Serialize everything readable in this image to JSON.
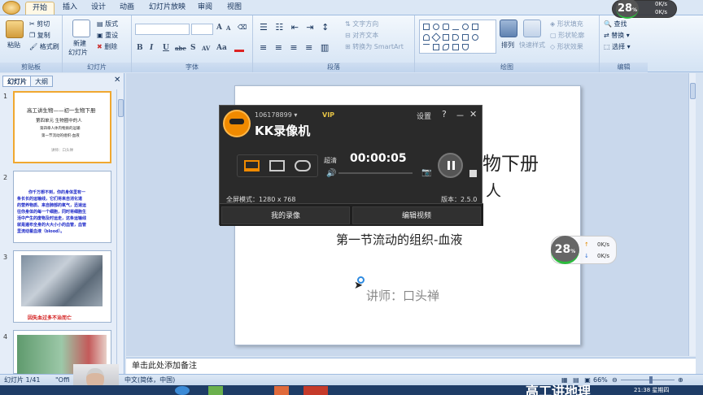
{
  "ribbon_tabs": [
    "开始",
    "插入",
    "设计",
    "动画",
    "幻灯片放映",
    "审阅",
    "视图"
  ],
  "clipboard": {
    "paste": "粘贴",
    "cut": "剪切",
    "copy": "复制",
    "format_painter": "格式刷",
    "title": "剪贴板"
  },
  "slides_group": {
    "new_slide": "新建",
    "new_slide2": "幻灯片",
    "layout": "版式",
    "reset": "重设",
    "delete": "删除",
    "title": "幻灯片"
  },
  "font_group": {
    "title": "字体",
    "bold": "B",
    "italic": "I",
    "underline": "U",
    "strike": "abe",
    "shadow": "S",
    "spacing": "AV",
    "case": "Aa",
    "grow": "A",
    "shrink": "A"
  },
  "paragraph_group": {
    "text_direction": "文字方向",
    "align_text": "对齐文本",
    "smartart": "转换为 SmartArt",
    "title": "段落"
  },
  "drawing_group": {
    "arrange": "排列",
    "quick_styles": "快速样式",
    "shape_fill": "形状填充",
    "shape_outline": "形状轮廓",
    "shape_effects": "形状效果",
    "title": "绘图"
  },
  "editing_group": {
    "find": "查找",
    "replace": "替换",
    "select": "选择",
    "title": "编辑"
  },
  "pane_tabs": {
    "slides": "幻灯片",
    "outline": "大纲"
  },
  "thumbnails": [
    {
      "num": "1",
      "lines": [
        "高工讲生物——初一生物下册",
        "第四单元  生物圈中的人",
        "第四章人体内物质的运输",
        "第一节流动的组织-血液",
        "讲师：口头禅"
      ]
    },
    {
      "num": "2",
      "lines": [
        "你千万想不到，你的身体里有一",
        "条长长的运输线，它们将来自消化道",
        "的营养物质、来自肺部的氧气，迅速运",
        "往你身体的每一个细胞，同时将细胞生",
        "活中产生的废物及时运走，这条运输线",
        "就是遍布全身的大大小小的血管，血管",
        "里流动着血液（blood）。"
      ]
    },
    {
      "num": "3",
      "caption": "因失血过多不治而亡"
    },
    {
      "num": "4"
    }
  ],
  "slide": {
    "title_partial": "物下册",
    "subtitle_partial": "人",
    "section": "第一节流动的组织-血液",
    "lecturer": "讲师：口头禅"
  },
  "notes_placeholder": "单击此处添加备注",
  "status": {
    "slide_count": "幻灯片 1/41",
    "theme": "\"Offi",
    "language": "中文(简体，中国)",
    "zoom": "66%"
  },
  "kk": {
    "user_id": "106178899",
    "vip": "VIP",
    "settings": "设置",
    "help": "?",
    "minimize": "－",
    "close": "✕",
    "app_name": "KK录像机",
    "quality": "超清",
    "timer": "00:00:05",
    "mode": "全屏模式：1280 x 768",
    "version": "版本：2.5.0",
    "my_recordings": "我的录像",
    "edit_video": "编辑视频"
  },
  "net_top": {
    "percent": "28",
    "unit": "%",
    "up": "0K/s",
    "down": "0K/s"
  },
  "net_mid": {
    "percent": "28",
    "unit": "%",
    "up": "0K/s",
    "down": "0K/s"
  },
  "taskbar": {
    "time": "21:38 星期四",
    "overlay": "高工讲地理"
  },
  "colors": {
    "kk_orange": "#f08a00",
    "ribbon_bg": "#dbe7f5",
    "net_green": "#2bbd3c"
  }
}
